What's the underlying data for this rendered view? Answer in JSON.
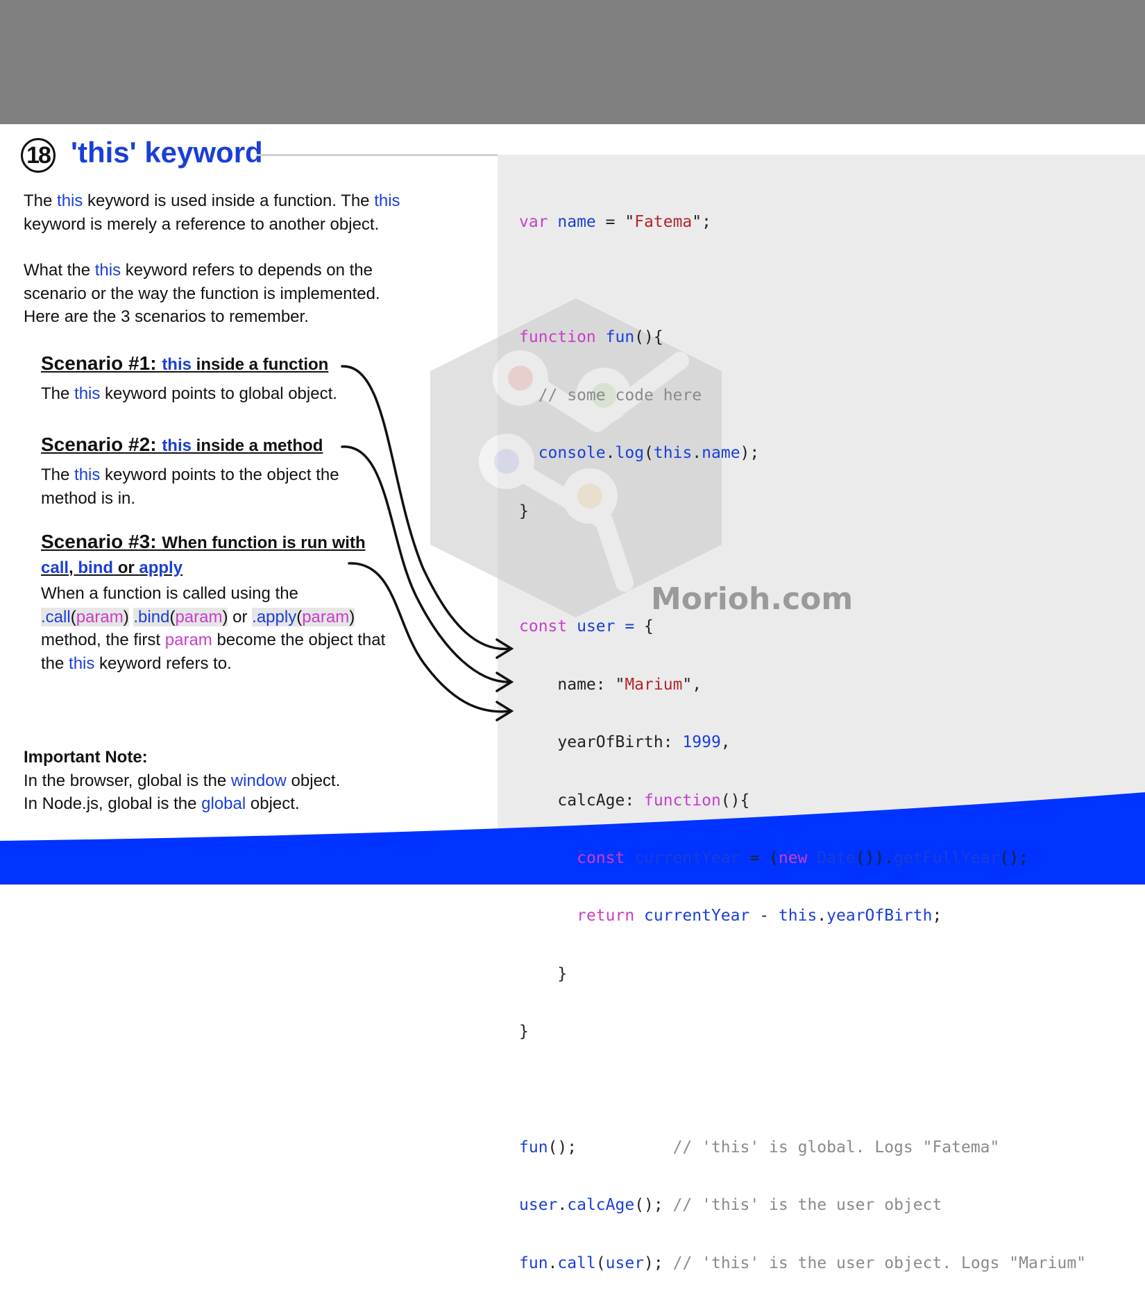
{
  "header": {
    "badge_number": "18",
    "title": "'this' keyword"
  },
  "intro": {
    "p1": {
      "a": "The ",
      "kw1": "this",
      "b": " keyword is used inside a function. The ",
      "kw2": "this",
      "c": " keyword is merely a reference to another object."
    },
    "p2": {
      "a": "What the ",
      "kw": "this",
      "b": " keyword refers to depends on the scenario or the way the function is implemented. Here are the 3 scenarios to remember."
    }
  },
  "scenarios": [
    {
      "label": "Scenario #1: ",
      "kw": "this",
      "rest": " inside a function",
      "desc": {
        "a": "The ",
        "kw": "this",
        "b": " keyword points to global object."
      }
    },
    {
      "label": "Scenario #2: ",
      "kw": "this",
      "rest": " inside a method",
      "desc": {
        "a": "The ",
        "kw": "this",
        "b": " keyword points to the object the method is in."
      }
    },
    {
      "label": "Scenario #3: ",
      "rest": "When function is run with",
      "call": "call",
      "comma": ", ",
      "bind": "bind",
      "or": " or ",
      "apply": "apply",
      "desc": {
        "a": "When a function is called using the",
        "call": ".call",
        "bind": ".bind",
        "apply": ".apply",
        "param": "param",
        "lp": "(",
        "rp": ")",
        "or": " or ",
        "b": "method, the first ",
        "c": " become the object that the ",
        "kw": "this",
        "d": " keyword refers to."
      }
    }
  ],
  "note": {
    "title": "Important Note:",
    "l1a": "In the browser, global is the ",
    "l1kw": "window",
    "l1b": " object.",
    "l2a": "In Node.js, global is the ",
    "l2kw": "global",
    "l2b": " object."
  },
  "code": {
    "l1": [
      "var",
      " name",
      " = \"",
      "Fatema",
      "\";"
    ],
    "l2": [
      "function",
      " fun",
      "(){"
    ],
    "l3": "  // some code here",
    "l4": [
      "  ",
      "console",
      ".",
      "log",
      "(",
      "this",
      ".",
      "name",
      ");"
    ],
    "l5": "}",
    "l6": [
      "const",
      " user",
      " =",
      " {"
    ],
    "l7": [
      "    name: \"",
      "Marium",
      "\","
    ],
    "l8": [
      "    yearOfBirth: ",
      "1999",
      ","
    ],
    "l9": [
      "    calcAge: ",
      "function",
      "(){"
    ],
    "l10": [
      "      ",
      "const",
      " currentYear",
      " = (",
      "new",
      " Date",
      "()).",
      "getFullYear",
      "();"
    ],
    "l11": [
      "      ",
      "return",
      " currentYear",
      " - ",
      "this",
      ".",
      "yearOfBirth",
      ";"
    ],
    "l12": "    }",
    "l13": "}",
    "l14": [
      "fun",
      "();",
      "          // 'this' is global. Logs \"Fatema\""
    ],
    "l15": [
      "user",
      ".",
      "calcAge",
      "();",
      " // 'this' is the user object"
    ],
    "l16": [
      "fun",
      ".",
      "call",
      "(",
      "user",
      ");",
      " // 'this' is the user object. Logs \"Marium\""
    ]
  },
  "watermark": {
    "text": "Morioh.com"
  },
  "colors": {
    "accent_blue": "#1a3fd6",
    "param_magenta": "#c83fc8",
    "string_red": "#b3262b",
    "top_bar": "#808080",
    "bottom_wave": "#0033ff",
    "code_bg": "#ebebeb"
  }
}
